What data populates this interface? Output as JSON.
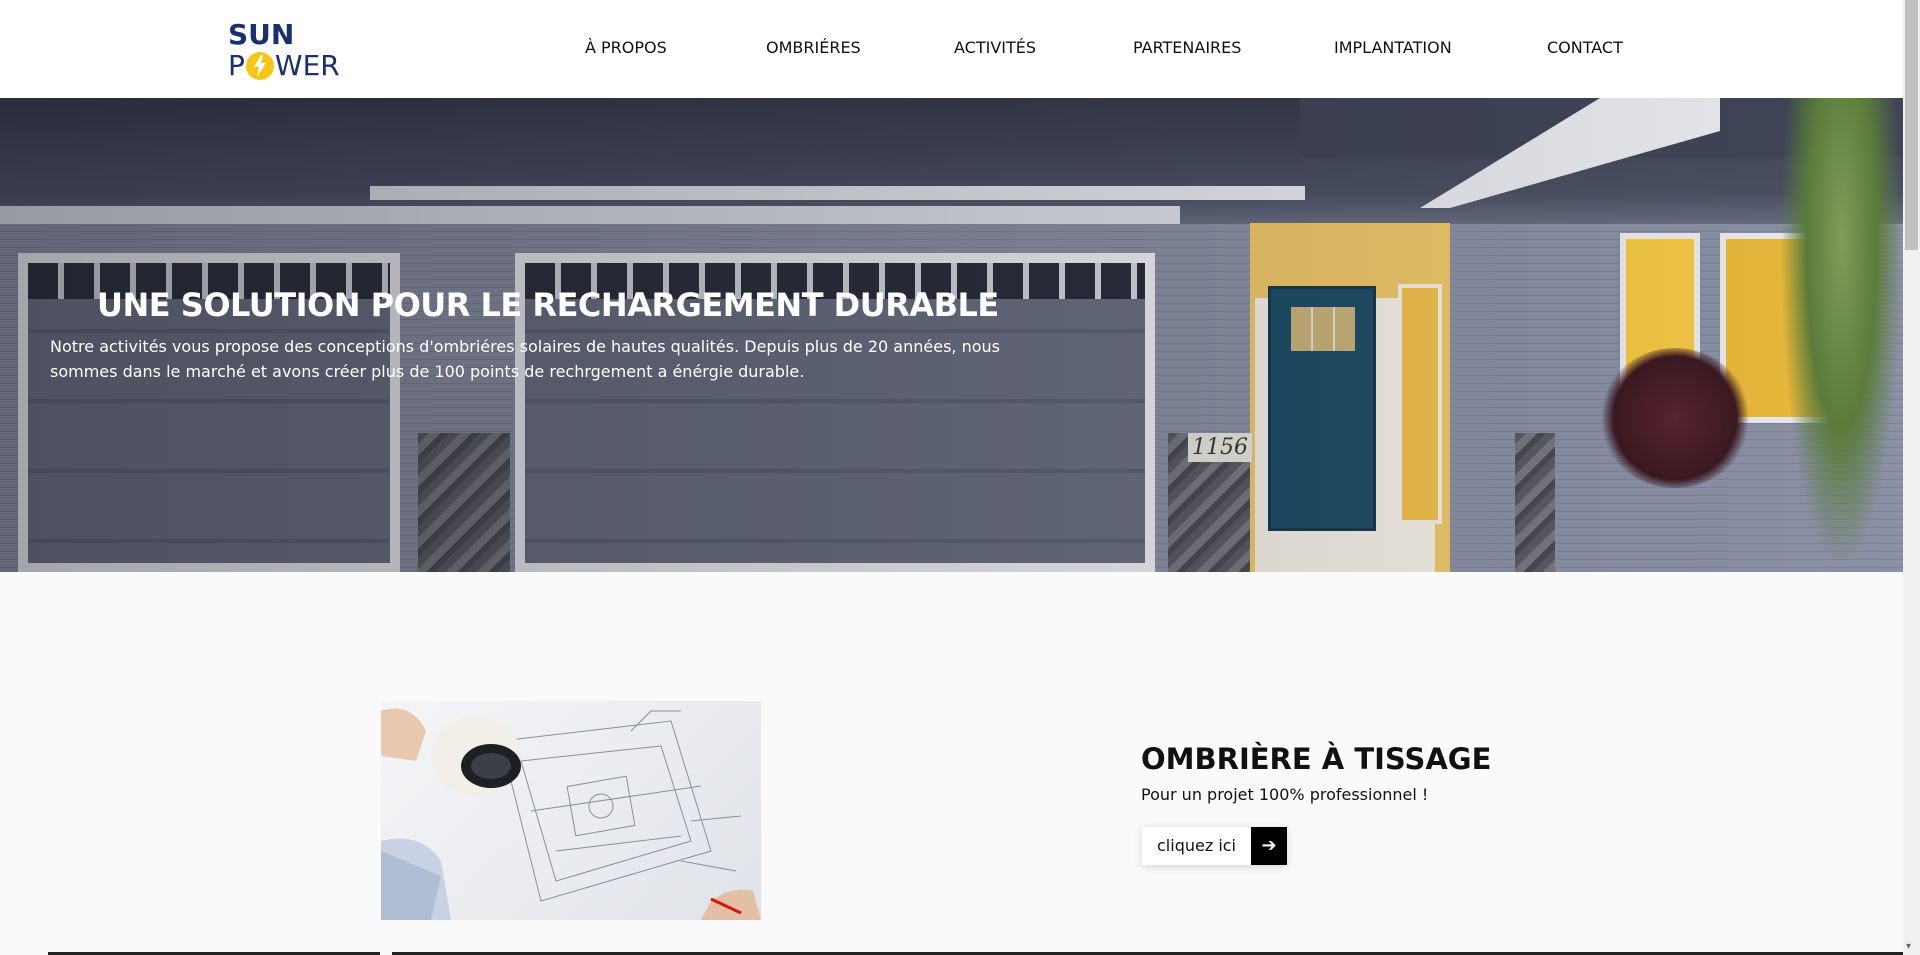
{
  "brand": {
    "line1": "SUN",
    "line2_prefix": "P",
    "line2_suffix": "WER",
    "accent": "#f5c518",
    "navy": "#1a2f6e"
  },
  "nav": {
    "items": [
      "À PROPOS",
      "OMBRIÉRES",
      "ACTIVITÉS",
      "PARTENAIRES",
      "IMPLANTATION",
      "CONTACT"
    ]
  },
  "hero": {
    "title": "UNE SOLUTION POUR LE RECHARGEMENT DURABLE",
    "text": "Notre activités vous propose des conceptions d'ombriéres solaires de hautes qualités. Depuis plus de 20 années, nous sommes dans le marché et avons créer plus de 100 points de rechrgement a énérgie durable.",
    "house_number": "1156"
  },
  "product": {
    "title": "OMBRIÈRE À TISSAGE",
    "subtitle": "Pour un projet 100% professionnel !",
    "cta_label": "cliquez ici",
    "cta_arrow": "➔"
  }
}
